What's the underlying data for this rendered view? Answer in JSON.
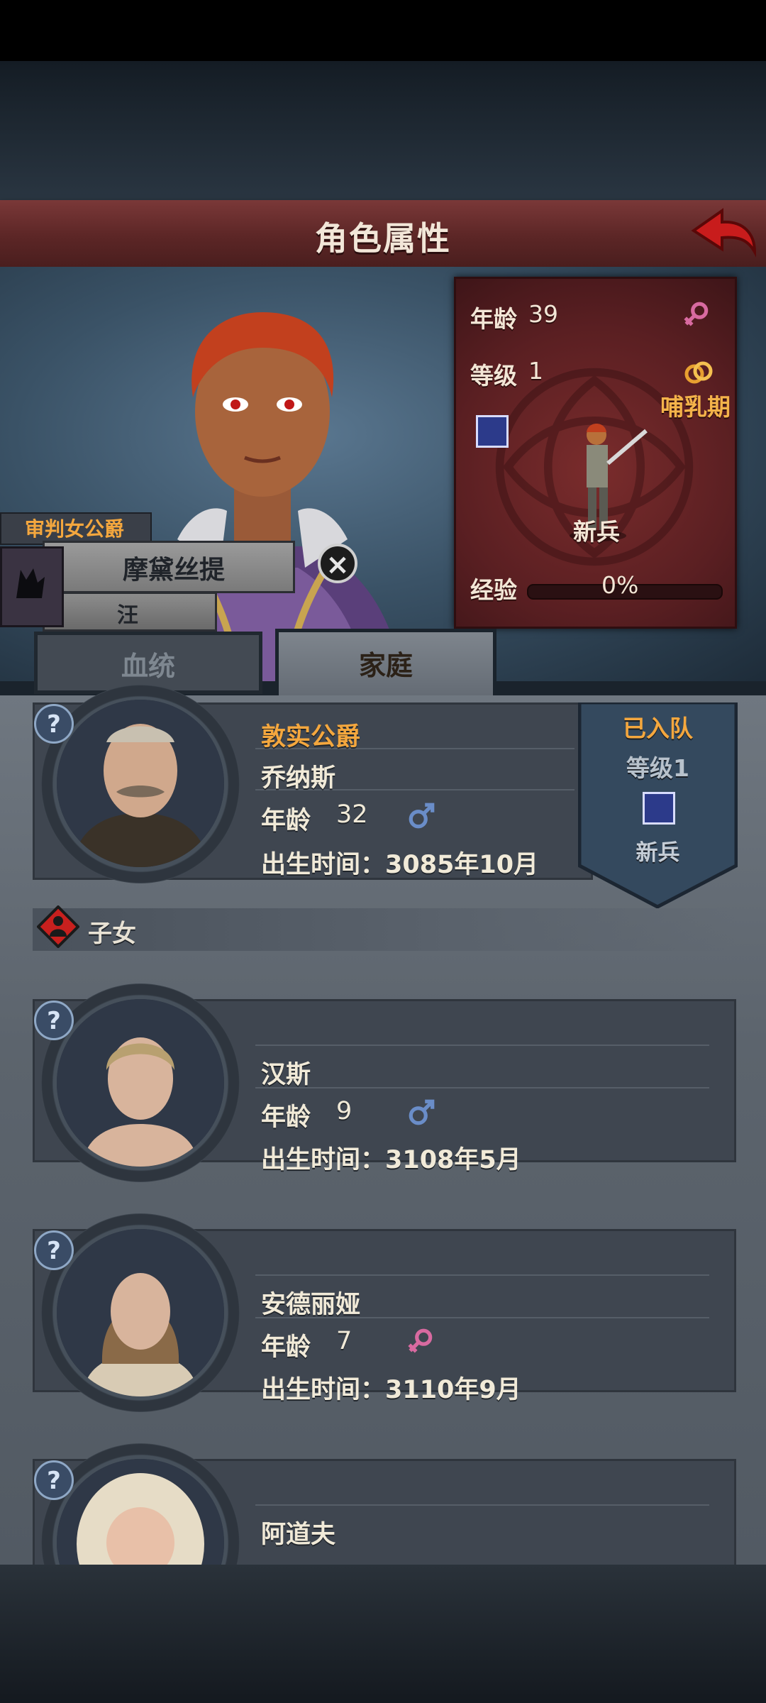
{
  "header": {
    "title": "角色属性"
  },
  "character": {
    "title": "审判女公爵",
    "name": "摩黛丝提",
    "surname": "汪",
    "stats": {
      "age_label": "年龄",
      "age": "39",
      "level_label": "等级",
      "level": "1",
      "status": "哺乳期",
      "class": "新兵",
      "exp_label": "经验",
      "exp": "0%",
      "exp_fraction": 0
    }
  },
  "tabs": [
    {
      "label": "血统",
      "selected": false
    },
    {
      "label": "家庭",
      "selected": true
    }
  ],
  "spouse": {
    "title": "敦实公爵",
    "name": "乔纳斯",
    "age_label": "年龄",
    "age": "32",
    "birth": "出生时间：3085年10月",
    "team_status": "已入队",
    "team_level": "等级1",
    "team_class": "新兵"
  },
  "children_header": "子女",
  "children": [
    {
      "name": "汉斯",
      "age_label": "年龄",
      "age": "9",
      "birth": "出生时间：3108年5月"
    },
    {
      "name": "安德丽娅",
      "age_label": "年龄",
      "age": "7",
      "birth": "出生时间：3110年9月"
    },
    {
      "name": "阿道夫",
      "age_label": "年龄",
      "age": "",
      "birth": ""
    }
  ],
  "colors": {
    "header": "#6b2e2e",
    "accent": "#f4a73e",
    "male": "#6a8dc8",
    "female": "#d86aa0"
  },
  "icons": [
    "back-arrow-icon",
    "female-icon",
    "male-icon",
    "ring-icon",
    "sword-class-icon",
    "close-icon",
    "question-icon",
    "children-icon",
    "wolf-banner-icon"
  ]
}
